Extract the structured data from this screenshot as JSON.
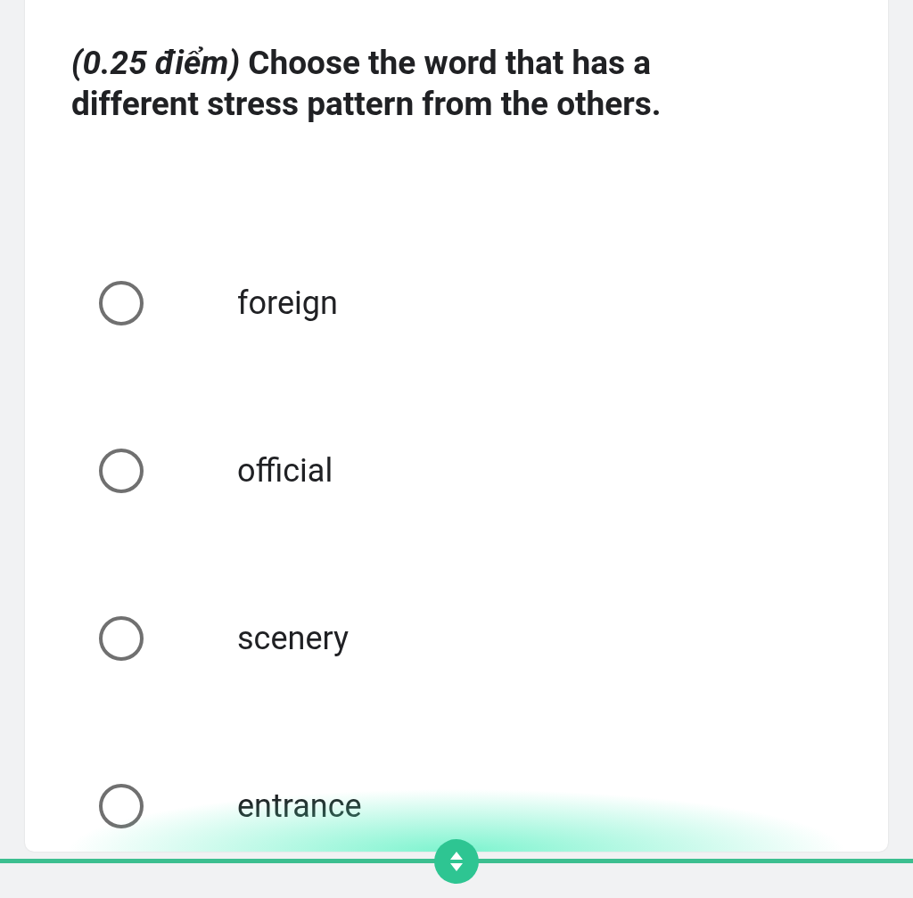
{
  "question": {
    "text": "*(0.25 điểm)*  Choose the word that has a different stress pattern from the others."
  },
  "options": [
    {
      "label": "foreign",
      "selected": false
    },
    {
      "label": "official",
      "selected": false
    },
    {
      "label": "scenery",
      "selected": false
    },
    {
      "label": "entrance",
      "selected": false
    }
  ]
}
